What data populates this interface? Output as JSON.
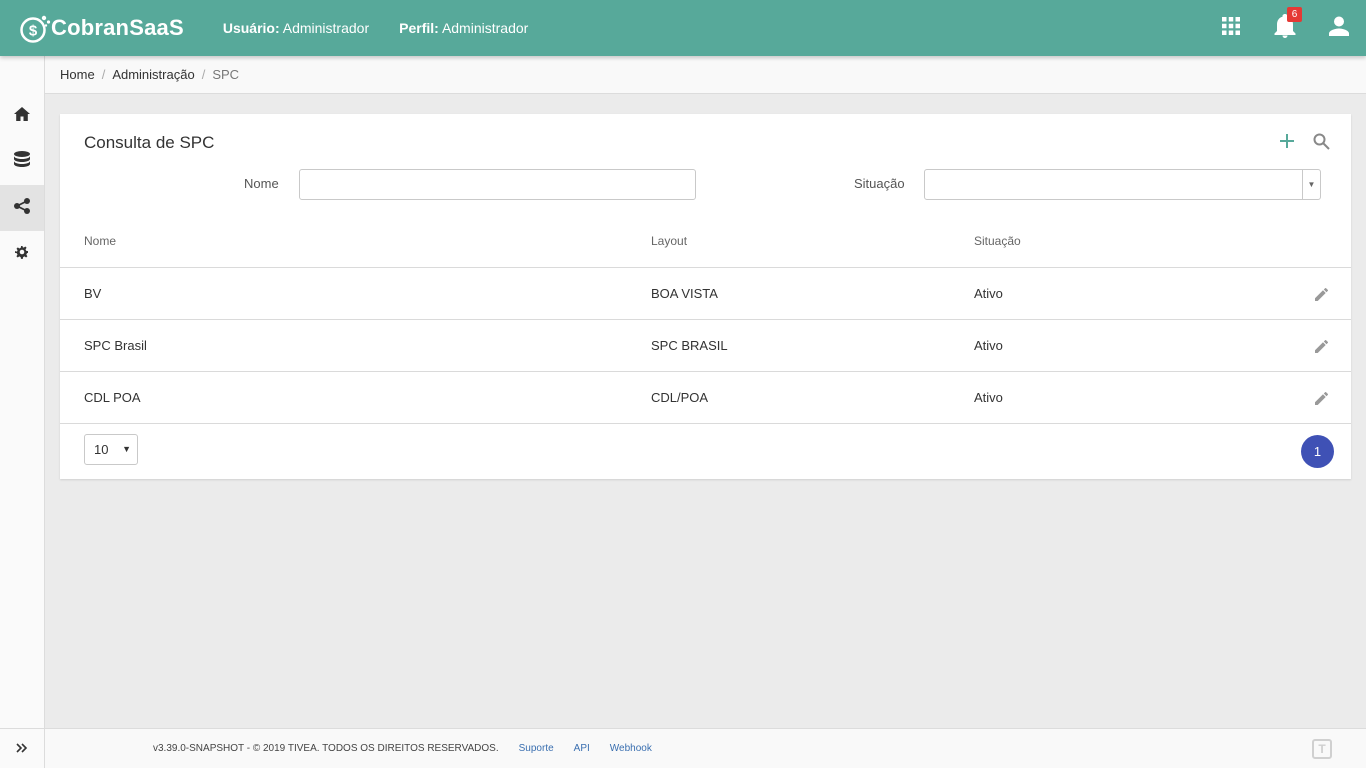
{
  "app": {
    "name": "CobranSaaS"
  },
  "header": {
    "user_label": "Usuário:",
    "user_value": "Administrador",
    "profile_label": "Perfil:",
    "profile_value": "Administrador",
    "notification_count": "6",
    "icons": [
      "apps-grid-icon",
      "bell-icon",
      "user-icon"
    ]
  },
  "sidebar": {
    "items": [
      {
        "icon": "home-icon",
        "active": false
      },
      {
        "icon": "database-icon",
        "active": false
      },
      {
        "icon": "share-icon",
        "active": true
      },
      {
        "icon": "gear-icon",
        "active": false
      }
    ],
    "expand_icon": "double-chevron-right-icon"
  },
  "breadcrumb": {
    "items": [
      "Home",
      "Administração",
      "SPC"
    ]
  },
  "card": {
    "title": "Consulta de SPC",
    "filters": {
      "nome_label": "Nome",
      "nome_value": "",
      "situacao_label": "Situação",
      "situacao_value": ""
    },
    "table": {
      "columns": [
        "Nome",
        "Layout",
        "Situação"
      ],
      "rows": [
        {
          "nome": "BV",
          "layout": "BOA VISTA",
          "situacao": "Ativo"
        },
        {
          "nome": "SPC Brasil",
          "layout": "SPC BRASIL",
          "situacao": "Ativo"
        },
        {
          "nome": "CDL POA",
          "layout": "CDL/POA",
          "situacao": "Ativo"
        }
      ]
    },
    "page_size": "10",
    "current_page": "1"
  },
  "footer": {
    "copyright": "v3.39.0-SNAPSHOT - © 2019 TIVEA. TODOS OS DIREITOS RESERVADOS.",
    "links": [
      "Suporte",
      "API",
      "Webhook"
    ],
    "logo_text": "T"
  },
  "colors": {
    "topbar": "#57a99a",
    "accent": "#3f51b5",
    "badge": "#e53935"
  }
}
